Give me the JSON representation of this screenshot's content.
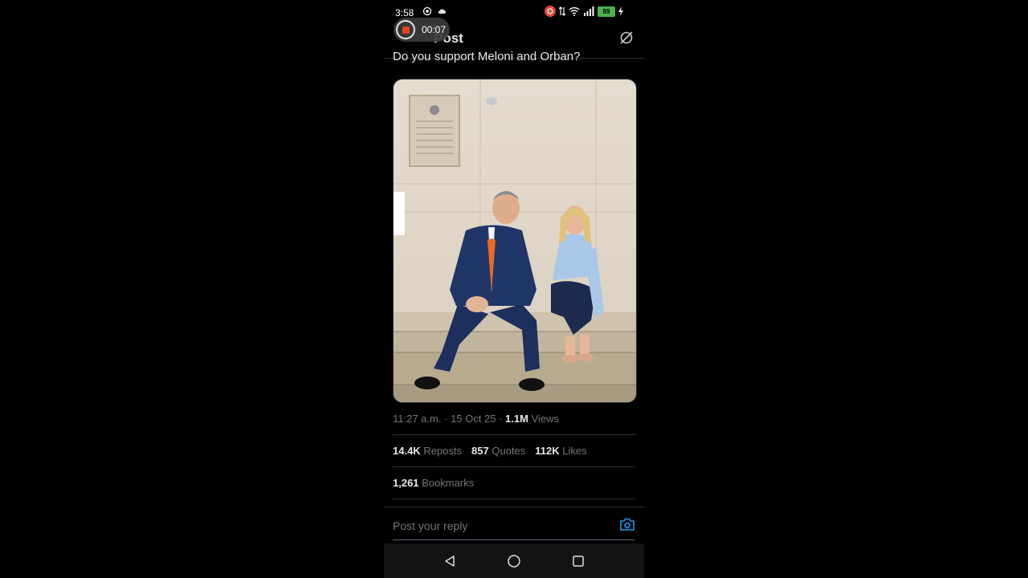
{
  "status_bar": {
    "time": "3:58",
    "battery": "99"
  },
  "screen_recorder": {
    "elapsed": "00:07"
  },
  "header": {
    "title": "Post"
  },
  "tweet": {
    "text": "Do you support Meloni and Orban?",
    "time": "11:27 a.m.",
    "date": "15 Oct 25",
    "views_count": "1.1M",
    "views_label": "Views",
    "separator": "·"
  },
  "stats": {
    "reposts_count": "14.4K",
    "reposts_label": "Reposts",
    "quotes_count": "857",
    "quotes_label": "Quotes",
    "likes_count": "112K",
    "likes_label": "Likes",
    "bookmarks_count": "1,261",
    "bookmarks_label": "Bookmarks"
  },
  "reply": {
    "placeholder": "Post your reply"
  },
  "colors": {
    "accent": "#1d9bf0",
    "background": "#000000",
    "muted": "#71767b",
    "record": "#e2441f"
  }
}
